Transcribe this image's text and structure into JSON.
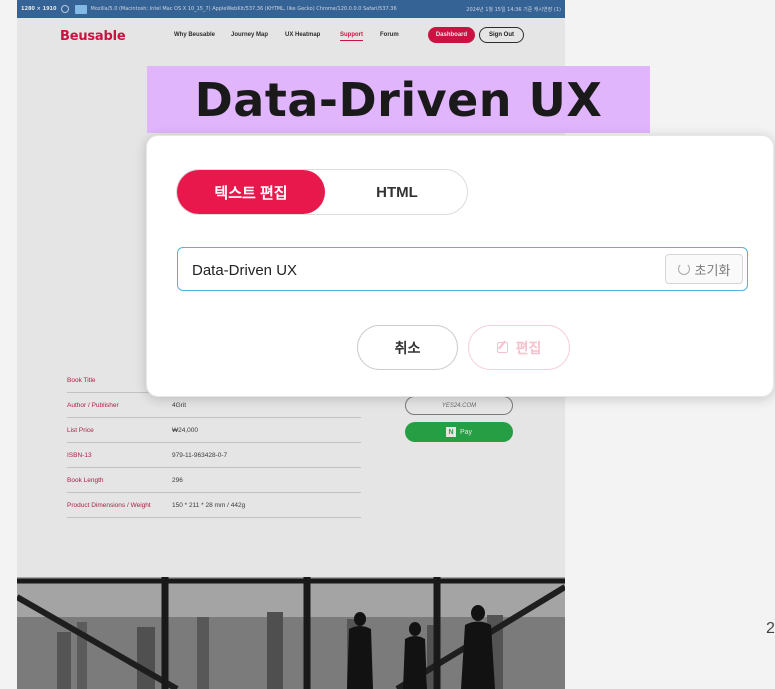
{
  "infobar": {
    "resolution": "1280 × 1910",
    "user_agent": "Mozilla/5.0 (Macintosh; Intel Mac OS X 10_15_7) AppleWebKit/537.36 (KHTML, like Gecko) Chrome/120.0.0.0 Safari/537.36",
    "datetime": "2024년 1월 15일 14:36 기준 캐시연장 (1)"
  },
  "nav": {
    "logo": "Beusable",
    "links": [
      "Why Beusable",
      "Journey Map",
      "UX Heatmap",
      "Support",
      "Forum"
    ],
    "active": "Support",
    "dashboard": "Dashboard",
    "signout": "Sign Out"
  },
  "book_table": [
    {
      "key": "Book Title",
      "value": ""
    },
    {
      "key": "Author / Publisher",
      "value": "4Grit"
    },
    {
      "key": "List Price",
      "value": "₩24,000"
    },
    {
      "key": "ISBN-13",
      "value": "979-11-963428-0-7"
    },
    {
      "key": "Book Length",
      "value": "296"
    },
    {
      "key": "Product Dimensions / Weight",
      "value": "150 * 211 * 28 mm / 442g"
    }
  ],
  "buy": {
    "yes24": "YES24.COM",
    "npay": "Pay"
  },
  "highlight_title": "Data-Driven UX",
  "modal": {
    "tab_text": "텍스트 편집",
    "tab_html": "HTML",
    "input_value": "Data-Driven UX",
    "reset": "초기화",
    "cancel": "취소",
    "edit": "편집"
  },
  "side_number": "2",
  "colors": {
    "brand": "#e3154a",
    "highlight": "#e1b5fb",
    "input_border": "#4db6e4",
    "npay": "#2bb24c"
  },
  "icons": [
    "info-icon",
    "monitor-icon",
    "reset-icon",
    "edit-icon",
    "npay-logo-icon"
  ]
}
